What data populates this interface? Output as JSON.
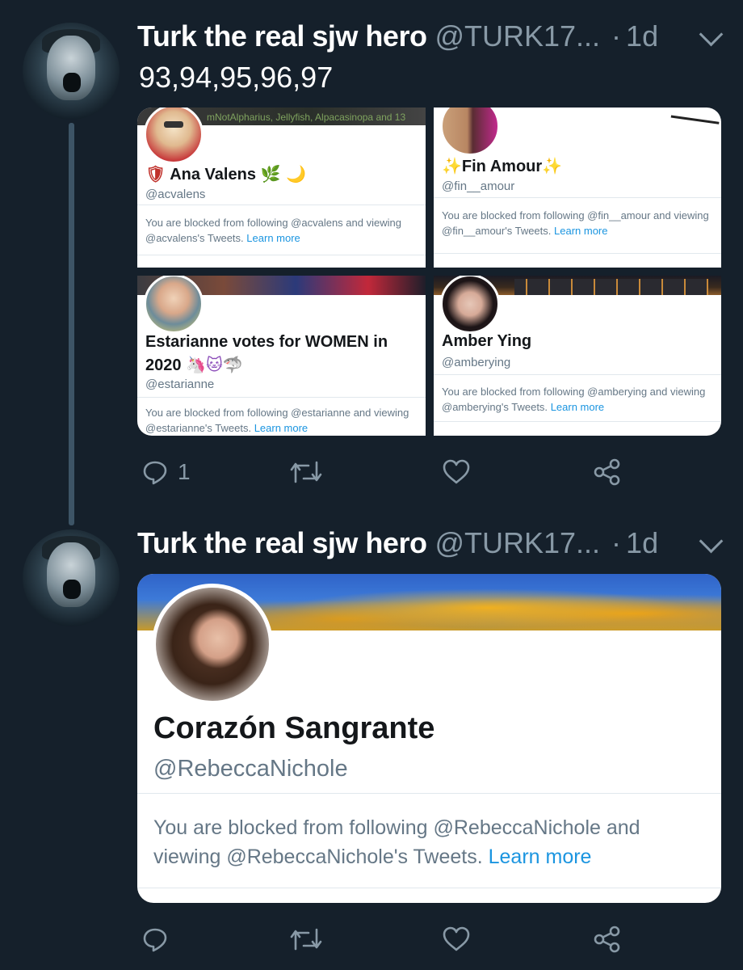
{
  "tweets": [
    {
      "author_name": "Turk the real sjw hero",
      "author_handle": "@TURK17...",
      "time": "1d",
      "text": "93,94,95,96,97",
      "cards": [
        {
          "banner_text": "mNotAlpharius, Jellyfish, Alpacasinopa and 13",
          "name": "Ana Valens",
          "name_prefix_emoji": "🛡",
          "name_suffix_emoji": "🌿 🌙",
          "handle": "@acvalens",
          "blocked_text": "You are blocked from following @acvalens and viewing @acvalens's Tweets.",
          "learn_more": "Learn more"
        },
        {
          "name": "Fin Amour",
          "name_prefix_emoji": "✨",
          "name_suffix_emoji": "✨",
          "handle": "@fin__amour",
          "blocked_text": "You are blocked from following @fin__amour and viewing @fin__amour's Tweets.",
          "learn_more": "Learn more"
        },
        {
          "name": "Estarianne votes for WOMEN in 2020",
          "name_suffix_emoji": "🦄🐱🦈",
          "handle": "@estarianne",
          "blocked_text": "You are blocked from following @estarianne and viewing @estarianne's Tweets.",
          "learn_more": "Learn more"
        },
        {
          "name": "Amber Ying",
          "handle": "@ambe​rying",
          "blocked_text": "You are blocked from following @amberying and viewing @amberying's Tweets.",
          "learn_more": "Learn more"
        }
      ],
      "reply_count": "1"
    },
    {
      "author_name": "Turk the real sjw hero",
      "author_handle": "@TURK17...",
      "time": "1d",
      "card": {
        "name": "Corazón Sangrante",
        "handle": "@RebeccaNichole",
        "blocked_text": "You are blocked from following @RebeccaNichole and viewing @RebeccaNichole's Tweets.",
        "learn_more": "Learn more"
      }
    }
  ],
  "separator_dot": "·",
  "icons": [
    "reply-icon",
    "retweet-icon",
    "like-icon",
    "share-icon",
    "chevron-down-icon"
  ],
  "colors": {
    "background": "#15202b",
    "secondary_text": "#8899a6",
    "link": "#1b95e0",
    "thread_line": "#3d5466"
  }
}
